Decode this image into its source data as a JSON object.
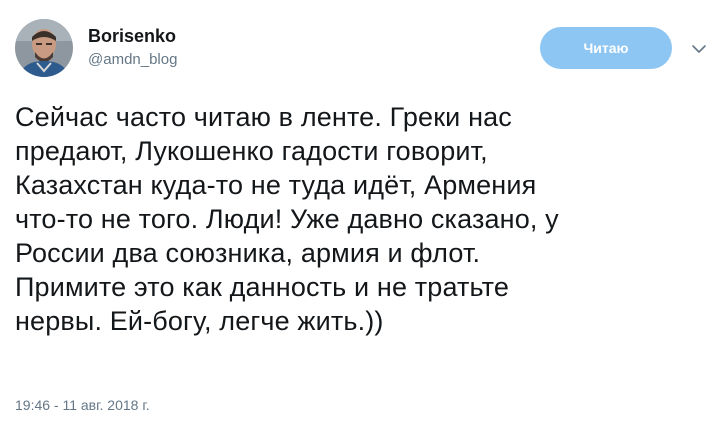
{
  "author": {
    "display_name": "Borisenko",
    "screen_name": "@amdn_blog",
    "avatar_icon": "user-avatar"
  },
  "follow_button": {
    "label": "Читаю",
    "color": "#8dc5f3"
  },
  "menu": {
    "icon": "chevron-down-icon"
  },
  "tweet": {
    "text": "Сейчас  часто читаю в ленте. Греки нас\nпредают, Лукошенко гадости говорит,\nКазахстан куда-то не туда идёт, Армения\nчто-то не того. Люди! Уже давно сказано, у\nРоссии два союзника, армия и флот.\nПримите это как данность и не тратьте\nнервы. Ей-богу, легче жить.))",
    "timestamp": "19:46 - 11 авг. 2018 г."
  }
}
